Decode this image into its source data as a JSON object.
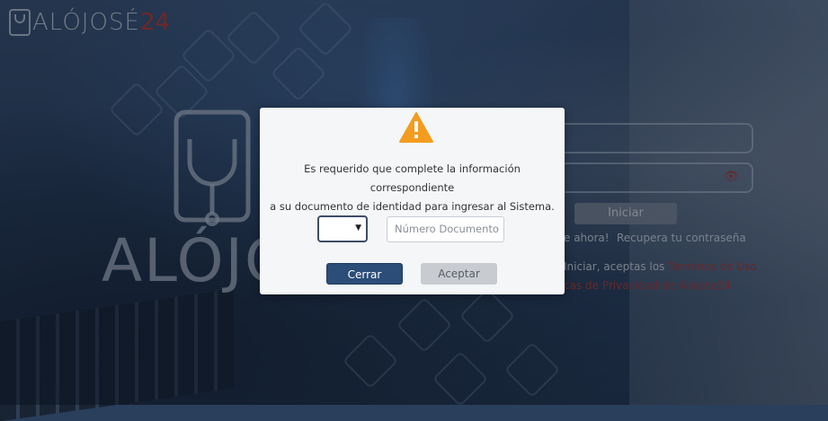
{
  "header": {
    "logo_text": "ALÓJOSÉ",
    "logo_number": "24"
  },
  "background": {
    "big_logo_text": "ALÓJOSÉ",
    "login_button": "Iniciar",
    "register_link": "e ahora!",
    "recover_link": "Recupera tu contraseña",
    "terms_prefix": "Iniciar, aceptas los ",
    "terms_link": "Terminos de Uso",
    "privacy_link": "cas de Privacidad de Alojose24"
  },
  "modal": {
    "message_line1": "Es requerido que complete la información correspondiente",
    "message_line2": "a su documento de identidad para ingresar al Sistema.",
    "document_type_value": "",
    "document_number_placeholder": "Número Documento",
    "close_button": "Cerrar",
    "accept_button": "Aceptar"
  },
  "colors": {
    "primary_button": "#2b4d78",
    "warning_icon": "#f39c1f",
    "brand_red": "#c0392b"
  },
  "icons": {
    "warning": "warning-triangle-icon",
    "eye": "eye-icon",
    "dropdown": "chevron-down-icon"
  }
}
